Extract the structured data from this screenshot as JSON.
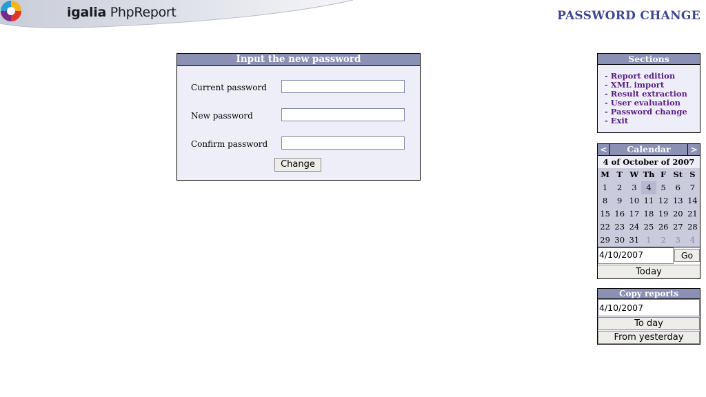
{
  "header": {
    "brand_prefix": "igalia",
    "brand_suffix": "PhpReport",
    "page_title": "PASSWORD CHANGE"
  },
  "password_form": {
    "title": "Input the new password",
    "current_label": "Current password",
    "new_label": "New password",
    "confirm_label": "Confirm password",
    "current_value": "",
    "new_value": "",
    "confirm_value": "",
    "submit_label": "Change"
  },
  "sections": {
    "title": "Sections",
    "items": [
      {
        "label": "- Report edition"
      },
      {
        "label": "- XML import"
      },
      {
        "label": "- Result extraction"
      },
      {
        "label": "- User evaluation"
      },
      {
        "label": "- Password change"
      },
      {
        "label": "- Exit"
      }
    ]
  },
  "calendar": {
    "prev": "<",
    "next": ">",
    "title": "Calendar",
    "current_date_text": "4 of October of 2007",
    "weekdays": [
      "M",
      "T",
      "W",
      "Th",
      "F",
      "St",
      "S"
    ],
    "weeks": [
      [
        "1",
        "2",
        "3",
        "4",
        "5",
        "6",
        "7"
      ],
      [
        "8",
        "9",
        "10",
        "11",
        "12",
        "13",
        "14"
      ],
      [
        "15",
        "16",
        "17",
        "18",
        "19",
        "20",
        "21"
      ],
      [
        "22",
        "23",
        "24",
        "25",
        "26",
        "27",
        "28"
      ],
      [
        "29",
        "30",
        "31",
        "1",
        "2",
        "3",
        "4"
      ]
    ],
    "date_input": "4/10/2007",
    "go_label": "Go",
    "today_label": "Today"
  },
  "copy_reports": {
    "title": "Copy reports",
    "date_input": "4/10/2007",
    "to_day_label": "To day",
    "from_yesterday_label": "From yesterday"
  },
  "colors": {
    "header_bg": "#8b90b5",
    "panel_bg": "#eeeef8",
    "title_color": "#3f4795",
    "link_color": "#5a1f84"
  }
}
